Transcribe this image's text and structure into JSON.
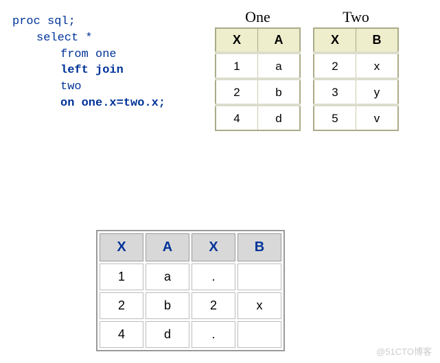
{
  "code": {
    "line1": "proc sql;",
    "line2": "select *",
    "line3": "from one",
    "line4": "left join",
    "line5": "two",
    "line6": "on one.x=two.x;"
  },
  "tables": {
    "one": {
      "title": "One",
      "headers": [
        "X",
        "A"
      ],
      "rows": [
        [
          "1",
          "a"
        ],
        [
          "2",
          "b"
        ],
        [
          "4",
          "d"
        ]
      ]
    },
    "two": {
      "title": "Two",
      "headers": [
        "X",
        "B"
      ],
      "rows": [
        [
          "2",
          "x"
        ],
        [
          "3",
          "y"
        ],
        [
          "5",
          "v"
        ]
      ]
    }
  },
  "result": {
    "headers": [
      "X",
      "A",
      "X",
      "B"
    ],
    "rows": [
      [
        "1",
        "a",
        ".",
        ""
      ],
      [
        "2",
        "b",
        "2",
        "x"
      ],
      [
        "4",
        "d",
        ".",
        ""
      ]
    ]
  },
  "watermark": "@51CTO博客",
  "chart_data": {
    "type": "table",
    "title": "SAS PROC SQL left join example",
    "input_tables": {
      "one": {
        "columns": [
          "X",
          "A"
        ],
        "rows": [
          [
            1,
            "a"
          ],
          [
            2,
            "b"
          ],
          [
            4,
            "d"
          ]
        ]
      },
      "two": {
        "columns": [
          "X",
          "B"
        ],
        "rows": [
          [
            2,
            "x"
          ],
          [
            3,
            "y"
          ],
          [
            5,
            "v"
          ]
        ]
      }
    },
    "result_columns": [
      "X",
      "A",
      "X",
      "B"
    ],
    "result_rows": [
      {
        "X": "1",
        "A": "a",
        "X2": ".",
        "B": ""
      },
      {
        "X": "2",
        "A": "b",
        "X2": "2",
        "B": "x"
      },
      {
        "X": "4",
        "A": "d",
        "X2": ".",
        "B": ""
      }
    ]
  }
}
